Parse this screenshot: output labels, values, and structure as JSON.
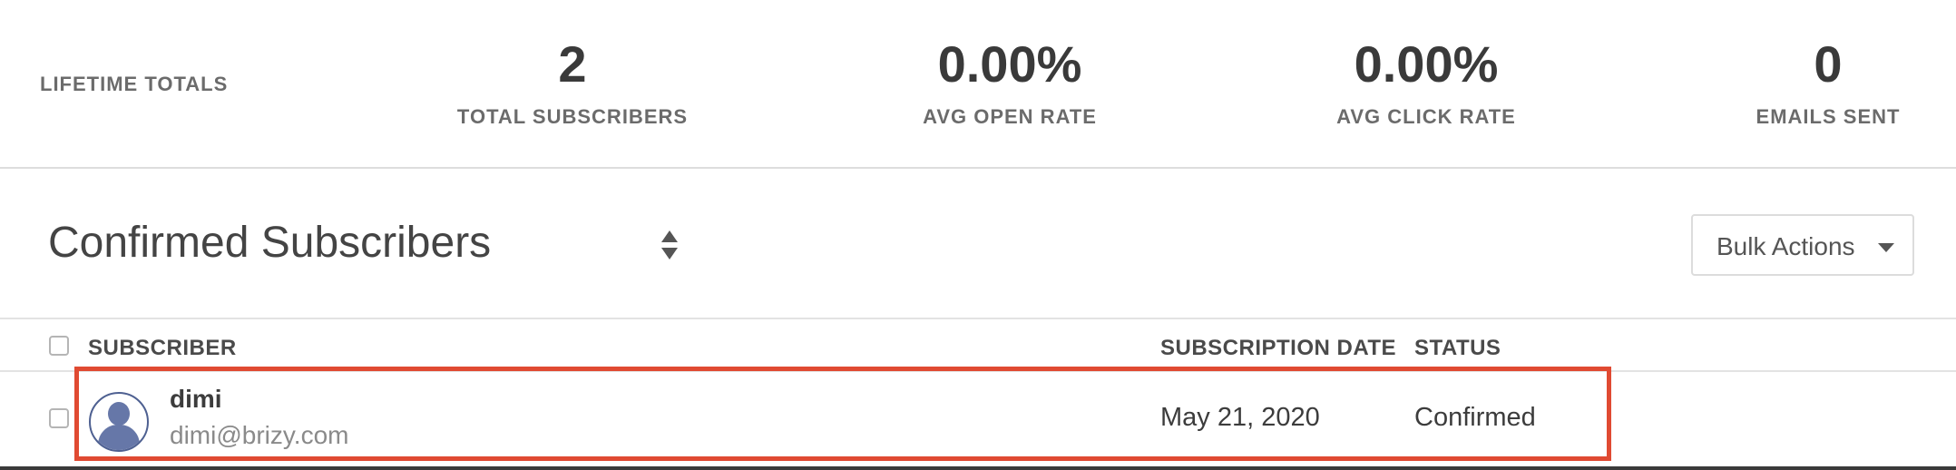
{
  "stats": {
    "heading": "LIFETIME TOTALS",
    "items": [
      {
        "value": "2",
        "label": "TOTAL SUBSCRIBERS"
      },
      {
        "value": "0.00%",
        "label": "AVG OPEN RATE"
      },
      {
        "value": "0.00%",
        "label": "AVG CLICK RATE"
      },
      {
        "value": "0",
        "label": "EMAILS SENT"
      }
    ]
  },
  "list": {
    "title": "Confirmed Subscribers",
    "bulk_actions_label": "Bulk Actions"
  },
  "table": {
    "columns": {
      "subscriber": "SUBSCRIBER",
      "date": "SUBSCRIPTION DATE",
      "status": "STATUS"
    },
    "rows": [
      {
        "name": "dimi",
        "email": "dimi@brizy.com",
        "date": "May 21, 2020",
        "status": "Confirmed"
      }
    ]
  },
  "colors": {
    "highlight": "#e04a32",
    "avatar": "#6677a8"
  },
  "icons": {
    "sort": "sort-arrows-icon",
    "bulk_caret": "caret-down-icon",
    "avatar": "user-silhouette-icon"
  }
}
